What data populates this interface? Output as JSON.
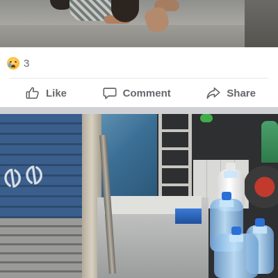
{
  "post": {
    "reactions": {
      "emoji_icon": "sad-face-icon",
      "count": "3"
    },
    "actions": {
      "like": {
        "label": "Like",
        "icon": "thumbs-up-icon"
      },
      "comment": {
        "label": "Comment",
        "icon": "comment-bubble-icon"
      },
      "share": {
        "label": "Share",
        "icon": "share-arrow-icon"
      }
    }
  },
  "next_post": {
    "image": {
      "graffiti_text": "ᱵᱵ"
    }
  },
  "colors": {
    "action_text": "#65676b",
    "separator": "#d0d1d5",
    "divider": "#e4e6eb"
  }
}
